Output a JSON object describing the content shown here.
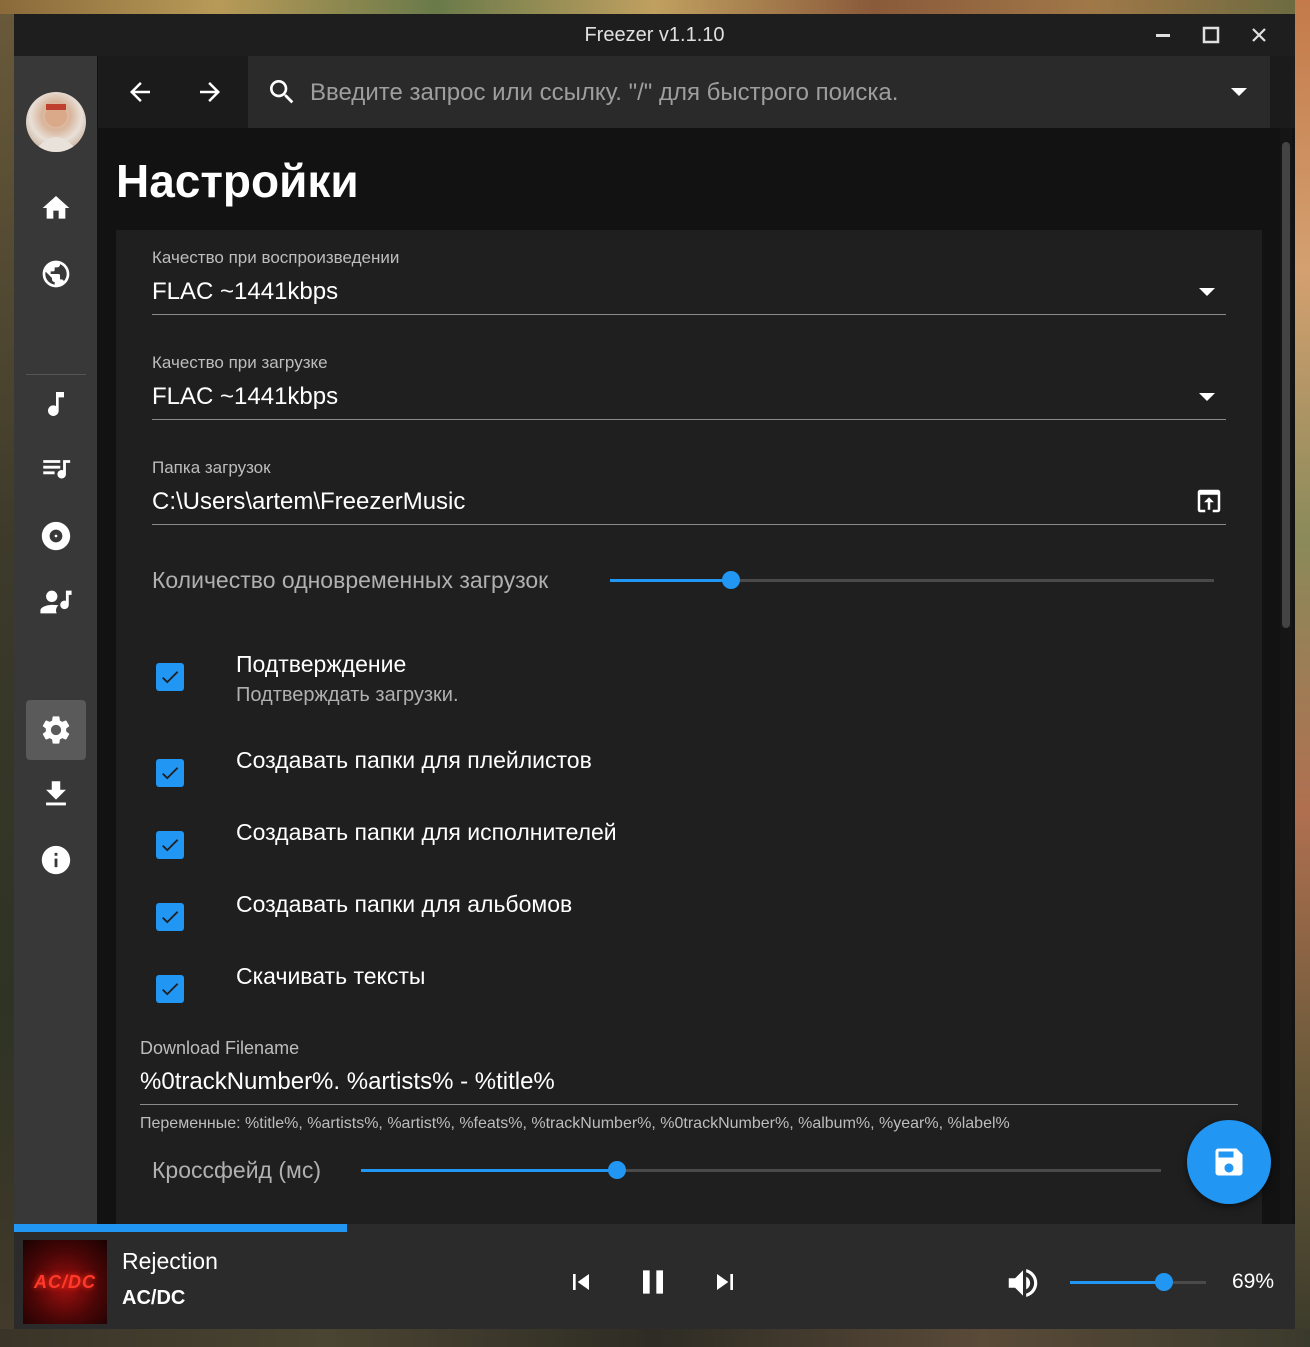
{
  "window": {
    "title": "Freezer v1.1.10"
  },
  "search": {
    "placeholder": "Введите запрос или ссылку. \"/\" для быстрого поиска."
  },
  "page": {
    "title": "Настройки"
  },
  "settings": {
    "playback_quality": {
      "label": "Качество при воспроизведении",
      "value": "FLAC ~1441kbps"
    },
    "download_quality": {
      "label": "Качество при загрузке",
      "value": "FLAC ~1441kbps"
    },
    "download_folder": {
      "label": "Папка загрузок",
      "value": "C:\\Users\\artem\\FreezerMusic"
    },
    "concurrent_downloads": {
      "label": "Количество одновременных загрузок",
      "fraction": 0.2
    },
    "checkboxes": [
      {
        "title": "Подтверждение",
        "subtitle": "Подтверждать загрузки.",
        "checked": true
      },
      {
        "title": "Создавать папки для плейлистов",
        "checked": true
      },
      {
        "title": "Создавать папки для исполнителей",
        "checked": true
      },
      {
        "title": "Создавать папки для альбомов",
        "checked": true
      },
      {
        "title": "Скачивать тексты",
        "checked": true
      }
    ],
    "download_filename": {
      "label": "Download Filename",
      "value": "%0trackNumber%. %artists% - %title%",
      "hint": "Переменные: %title%, %artists%, %artist%, %feats%, %trackNumber%, %0trackNumber%, %album%, %year%, %label%"
    },
    "crossfade": {
      "label": "Кроссфейд (мс)",
      "fraction": 0.32
    }
  },
  "player": {
    "title": "Rejection",
    "artist": "AC/DC",
    "cover_text": "AC/DC",
    "progress": 0.26,
    "volume_fraction": 0.69,
    "volume_label": "69%"
  },
  "icons": {
    "sidebar": [
      "home-icon",
      "globe-icon",
      "music-note-icon",
      "playlist-icon",
      "album-icon",
      "artist-icon",
      "settings-icon",
      "download-icon",
      "info-icon"
    ]
  },
  "colors": {
    "accent": "#2196f3",
    "background": "#121212",
    "panel": "#1f1f1f",
    "sidebar": "#383838"
  }
}
